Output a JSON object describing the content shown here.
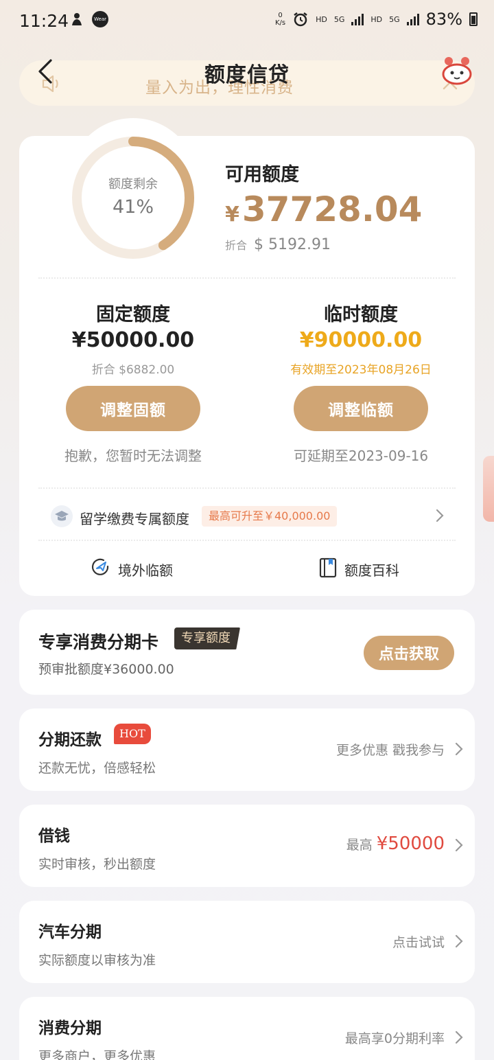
{
  "status_bar": {
    "time": "11:24",
    "net_speed_value": "0",
    "net_speed_unit": "K/s",
    "hd1": "HD",
    "net1": "5G",
    "hd2": "HD",
    "net2": "5G",
    "battery": "83%"
  },
  "header": {
    "title": "额度信贷",
    "notice": "量入为出，理性消费"
  },
  "credit": {
    "ring_label": "额度剩余",
    "ring_percent": "41%",
    "ring_fraction": 0.41,
    "available_label": "可用额度",
    "available_currency": "¥",
    "available_amount": "37728.04",
    "usd_label": "折合",
    "usd_amount": "$ 5192.91"
  },
  "fixed": {
    "title": "固定额度",
    "amount": "¥50000.00",
    "sub": "折合 $6882.00",
    "button": "调整固额",
    "note": "抱歉，您暂时无法调整"
  },
  "temp": {
    "title": "临时额度",
    "amount": "¥90000.00",
    "sub": "有效期至2023年08月26日",
    "button": "调整临额",
    "note": "可延期至2023-09-16"
  },
  "study": {
    "label": "留学缴费专属额度",
    "badge": "最高可升至￥40,000.00"
  },
  "tools": {
    "overseas": "境外临额",
    "wiki": "额度百科"
  },
  "promo": {
    "title": "专享消费分期卡",
    "badge": "专享额度",
    "sub": "预审批额度¥36000.00",
    "button": "点击获取"
  },
  "rows": [
    {
      "title": "分期还款",
      "badge": "HOT",
      "sub": "还款无忧，倍感轻松",
      "right": "更多优惠 戳我参与"
    },
    {
      "title": "借钱",
      "sub": "实时审核，秒出额度",
      "right_prefix": "最高",
      "right_highlight": "¥50000"
    },
    {
      "title": "汽车分期",
      "sub": "实际额度以审核为准",
      "right": "点击试试"
    },
    {
      "title": "消费分期",
      "sub": "更多商户，更多优惠",
      "right": "最高享0分期利率"
    }
  ],
  "colors": {
    "accent": "#d0a574",
    "amount_gold": "#b88a5c",
    "temp_amount": "#eeaa1a",
    "hot_red": "#e84b3c"
  }
}
